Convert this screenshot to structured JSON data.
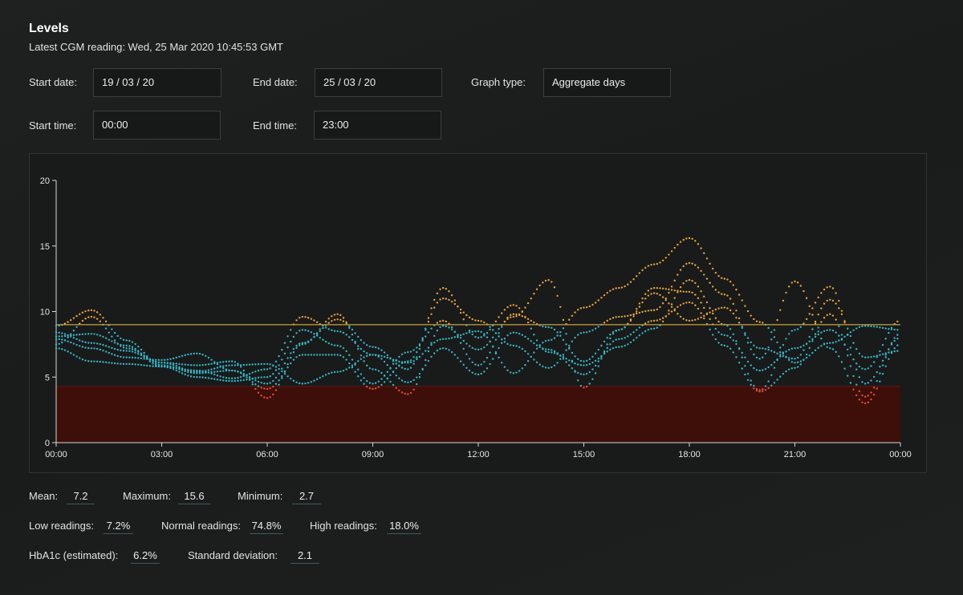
{
  "header": {
    "title": "Levels",
    "latest_reading": "Latest CGM reading: Wed, 25 Mar 2020 10:45:53 GMT"
  },
  "filters": {
    "start_date_label": "Start date:",
    "start_date": "19 / 03 / 20",
    "end_date_label": "End date:",
    "end_date": "25 / 03 / 20",
    "graph_type_label": "Graph type:",
    "graph_type": "Aggregate days",
    "start_time_label": "Start time:",
    "start_time": "00:00",
    "end_time_label": "End time:",
    "end_time": "23:00"
  },
  "colors": {
    "low": "#e8503a",
    "normal": "#35b7c6",
    "high": "#e8a53a",
    "low_band": "#3d0f08",
    "high_line": "#c9a23a"
  },
  "chart_data": {
    "type": "scatter",
    "ylim": [
      0,
      20
    ],
    "yticks": [
      "0",
      "5",
      "10",
      "15",
      "20"
    ],
    "xlim_hours": [
      0,
      24
    ],
    "xticks": [
      "00:00",
      "03:00",
      "06:00",
      "09:00",
      "12:00",
      "15:00",
      "18:00",
      "21:00",
      "00:00"
    ],
    "thresholds": {
      "low": 4.3,
      "high": 9
    },
    "series_hourly": [
      [
        8.4,
        7.6,
        7.0,
        6.1,
        5.4,
        5.9,
        6.0,
        4.5,
        5.4,
        6.7,
        6.1,
        7.9,
        8.5,
        5.3,
        7.8,
        10.3,
        11.8,
        13.6,
        15.6,
        12.5,
        9.2,
        6.1,
        7.6,
        8.9,
        8.6
      ],
      [
        7.9,
        7.2,
        6.5,
        6.3,
        6.8,
        5.5,
        4.5,
        7.6,
        9.4,
        7.3,
        5.6,
        11.8,
        8.0,
        10.5,
        6.9,
        5.9,
        7.3,
        8.7,
        12.4,
        9.0,
        4.0,
        8.6,
        11.9,
        4.5,
        8.0
      ],
      [
        7.5,
        9.6,
        7.2,
        6.1,
        5.9,
        6.2,
        3.4,
        7.5,
        9.8,
        5.6,
        3.7,
        8.9,
        7.1,
        9.6,
        12.4,
        4.2,
        8.6,
        11.8,
        11.5,
        8.2,
        5.5,
        7.2,
        8.6,
        5.6,
        9.3
      ],
      [
        8.9,
        10.1,
        7.8,
        5.9,
        5.3,
        5.5,
        4.1,
        6.7,
        6.7,
        4.1,
        6.2,
        11.0,
        9.3,
        7.4,
        5.7,
        8.4,
        9.6,
        10.1,
        13.7,
        11.3,
        6.4,
        12.3,
        7.2,
        3.0,
        7.5
      ],
      [
        8.1,
        8.3,
        7.4,
        5.8,
        5.5,
        4.9,
        5.6,
        9.6,
        8.5,
        6.7,
        4.6,
        7.2,
        5.2,
        8.4,
        7.1,
        5.2,
        7.9,
        9.3,
        10.7,
        7.4,
        3.9,
        5.7,
        9.8,
        3.5,
        8.3
      ],
      [
        7.2,
        6.2,
        6.0,
        5.8,
        5.0,
        4.7,
        5.0,
        8.6,
        7.4,
        4.5,
        6.9,
        9.3,
        5.9,
        9.8,
        8.8,
        6.2,
        8.6,
        11.4,
        9.3,
        10.3,
        7.2,
        6.4,
        10.9,
        6.5,
        7.0
      ]
    ]
  },
  "stats": {
    "mean_label": "Mean:",
    "mean": "7.2",
    "max_label": "Maximum:",
    "max": "15.6",
    "min_label": "Minimum:",
    "min": "2.7",
    "low_label": "Low readings:",
    "low": "7.2%",
    "normal_label": "Normal readings:",
    "normal": "74.8%",
    "high_label": "High readings:",
    "high": "18.0%",
    "hba1c_label": "HbA1c (estimated):",
    "hba1c": "6.2%",
    "sd_label": "Standard deviation:",
    "sd": "2.1"
  }
}
